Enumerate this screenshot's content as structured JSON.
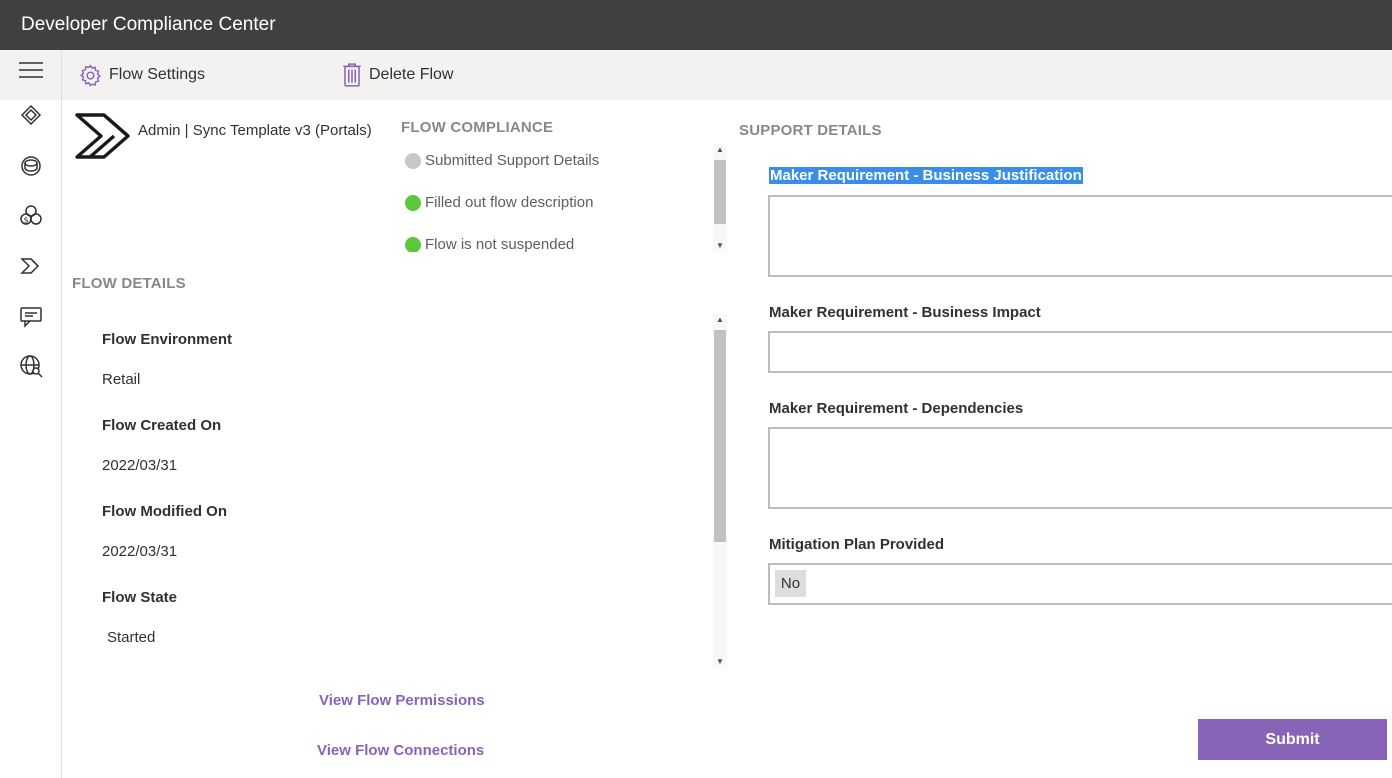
{
  "app": {
    "title": "Developer Compliance Center"
  },
  "toolbar": {
    "flow_settings_label": "Flow Settings",
    "delete_flow_label": "Delete Flow"
  },
  "nav": {
    "icons": [
      "hamburger-icon",
      "apps-icon",
      "database-icon",
      "dollar-cubes-icon",
      "power-automate-icon",
      "chat-icon",
      "globe-search-icon"
    ]
  },
  "flow": {
    "name": "Admin | Sync Template v3 (Portals)"
  },
  "compliance": {
    "title": "FLOW COMPLIANCE",
    "items": [
      {
        "label": "Submitted Support Details",
        "status_color": "#c8c8c8"
      },
      {
        "label": "Filled out flow description",
        "status_color": "#5ac939"
      },
      {
        "label": "Flow is not suspended",
        "status_color": "#5ac939"
      }
    ]
  },
  "details": {
    "title": "FLOW DETAILS",
    "environment_label": "Flow Environment",
    "environment_value": "Retail",
    "created_label": "Flow Created On",
    "created_value": "2022/03/31",
    "modified_label": "Flow Modified On",
    "modified_value": "2022/03/31",
    "state_label": "Flow State",
    "state_value": "Started"
  },
  "links": {
    "permissions": "View Flow Permissions",
    "connections": "View Flow Connections"
  },
  "support": {
    "title": "SUPPORT DETAILS",
    "justification_label": "Maker Requirement - Business Justification",
    "justification_value": "",
    "impact_label": "Maker Requirement - Business Impact",
    "impact_value": "",
    "dependencies_label": "Maker Requirement - Dependencies",
    "dependencies_value": "",
    "mitigation_label": "Mitigation Plan Provided",
    "mitigation_value": "No"
  },
  "submit_label": "Submit",
  "colors": {
    "accent": "#8764b8",
    "titlebar": "#404040",
    "selection": "#3a8ee6"
  }
}
